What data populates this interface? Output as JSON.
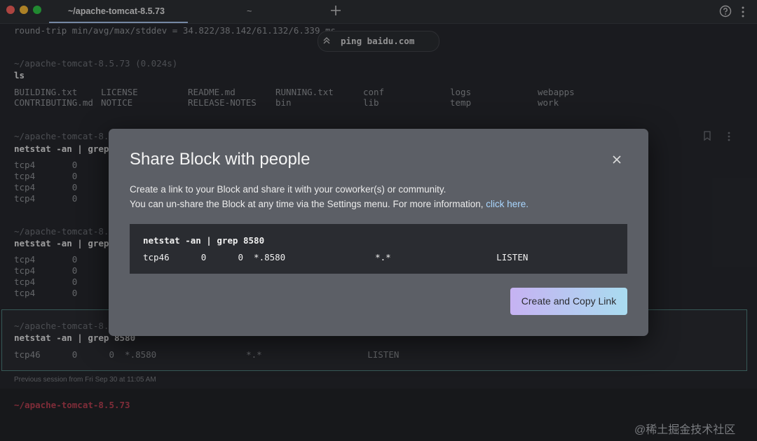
{
  "colors": {
    "background": "#1e2024",
    "modal": "#5c5f66",
    "accent_link": "#a9d6ff",
    "prompt_red": "#b83a4b",
    "selected_border": "#4a7f7a"
  },
  "window": {
    "traffic_lights": [
      "#ff5f57",
      "#febc2e",
      "#28c840"
    ],
    "tabs": [
      {
        "label": "~/apache-tomcat-8.5.73",
        "active": true
      },
      {
        "label": "~",
        "active": false
      }
    ],
    "icons": {
      "new_tab": "plus-icon",
      "help": "help-circle-icon",
      "menu": "vertical-ellipsis-icon"
    }
  },
  "terminal": {
    "ping_summary": "round-trip min/avg/max/stddev = 34.822/38.142/61.132/6.339 ms",
    "sticky_command": "ping baidu.com",
    "block_ls": {
      "header": "~/apache-tomcat-8.5.73 (0.024s)",
      "command": "ls",
      "columns": [
        [
          "BUILDING.txt",
          "CONTRIBUTING.md"
        ],
        [
          "LICENSE",
          "NOTICE"
        ],
        [
          "README.md",
          "RELEASE-NOTES"
        ],
        [
          "RUNNING.txt",
          "bin"
        ],
        [
          "conf",
          "lib"
        ],
        [
          "logs",
          "temp"
        ],
        [
          "webapps",
          "work"
        ]
      ]
    },
    "block2": {
      "header": "~/apache-tomcat-8.5.",
      "command": "netstat -an | grep",
      "rows": [
        "tcp4       0",
        "tcp4       0",
        "tcp4       0",
        "tcp4       0"
      ]
    },
    "block3": {
      "header": "~/apache-tomcat-8.5.",
      "command": "netstat -an | grep",
      "rows": [
        "tcp4       0",
        "tcp4       0",
        "tcp4       0",
        "tcp4       0"
      ]
    },
    "block4": {
      "header": "~/apache-tomcat-8.5.",
      "command": "netstat -an | grep 8580",
      "row": "tcp46      0      0  *.8580                 *.*                    LISTEN"
    },
    "previous_session": "Previous session from Fri Sep 30 at 11:05 AM",
    "prompt": "~/apache-tomcat-8.5.73"
  },
  "modal": {
    "title": "Share Block with people",
    "description_line1": "Create a link to your Block and share it with your coworker(s) or community.",
    "description_line2": "You can un-share the Block at any time via the Settings menu. For more information, ",
    "link_text": "click here.",
    "preview_command": "netstat -an | grep 8580",
    "preview_output": "tcp46      0      0  *.8580                 *.*                    LISTEN",
    "button_label": "Create and Copy Link",
    "close_icon": "close-icon"
  },
  "watermark": "@稀土掘金技术社区"
}
